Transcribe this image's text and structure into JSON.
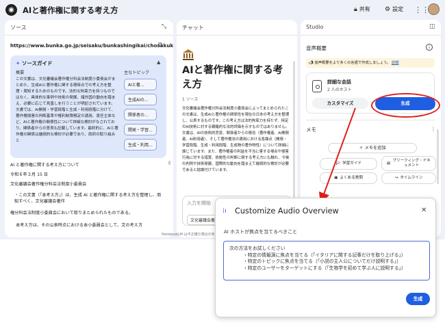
{
  "app": {
    "title": "AIと著作権に関する考え方",
    "share": "共有",
    "settings": "設定"
  },
  "source_panel": {
    "header": "ソース",
    "url": "https://www.bunka.go.jp/seisaku/bunkashingikai/chosakuken...",
    "guide": {
      "title": "ソースガイド",
      "summary_label": "概要",
      "topics_label": "主なトピック",
      "summary": "この文書は、文化審議会著作権分科会法制度小委員会がまとめた、生成AIと著作権に関する現時点での考え方を整理・周知するためのものです。法的な拘束力を持つものではなく、具体的な事例や技術の発展、諸外国の動向を踏まえ、必要に応じて見直しを行うことが明記されています。文書では、AI開発・学習段階と生成・利用段階に分けて、著作権侵害の判断基準や権利制限規定の適用、責任主体など、AIと著作権の関係性について詳細な検討がなされており、関係者からの意見も記載しています。最終的に、AIと著作権の関係は継続的な検討が必要であり、政府の取り組みと",
      "topics": [
        "AIと著...",
        "生成AIの...",
        "関係者の...",
        "開発・学習...",
        "生成・利用..."
      ]
    },
    "body": {
      "line1": "AI と著作権に関する考え方について",
      "line2": "令和６年３月 15 日",
      "line3": "文化審議会著作権分科会法制度小委員会",
      "bullet": "この文書（「本考え方」）は、生成 AI と著作権に関する考え方を整理し、周知すべく、文化審議会著作",
      "line4": "権分科会法制度小委員会において取りまとめられたものである。",
      "line5": "本考え方は、その公表時点における本小委員会として、文の考え方"
    },
    "footer": "NotebookLM は不正確な場合があります。"
  },
  "chat_panel": {
    "header": "チャット",
    "title": "AIと著作権に関する考え方",
    "count": "1 ソース",
    "body": "文化審議会著作権分科会法制度小委員会によってまとめられたこの文書は、生成AIと著作権の関係性を現在の日本の考え方を整理し、公表するものです。この考え方は法的拘束力を持たず、特定のAI技術に対する網羅的な法的評価を示すものではありません。文書は、AIの技術的背景、関係者からの懸念（著作権者、AI開発者、AI利用者）、そして著作権法の適用における各論点（開発・学習段階、生成・利用段階、生成物の著作物性）について詳細に論じています。また、著作権者の利益を不当に害する場合や侵害行為に対する措置、依拠性の判断に関する考え方にも触れ、今後の判例や技術発展、国際的な動向を踏まえて継続的な検討が必要であると結論付けています。",
    "input_placeholder": "入力を開始",
    "input_chip": "文化審議会著作権分..."
  },
  "studio_panel": {
    "header": "Studio",
    "audio_label": "音声概要",
    "banner_text": "音声概要をより多くの言語で作成しましょう。",
    "banner_link": "詳細",
    "card_title": "詳細な会話",
    "card_sub": "2 人のホスト",
    "customize": "カスタマイズ",
    "generate": "生成",
    "memo_label": "メモ",
    "add_note": "＋ メモを追加",
    "study_guide": "学習ガイド",
    "briefing": "ブリーフィング・ドキュメント",
    "faq": "よくある質問",
    "timeline": "タイムライン"
  },
  "modal": {
    "title": "Customize Audio Overview",
    "label": "AI ホストが焦点を当てるべきこと",
    "placeholder": "次の方法をお試しください",
    "items": [
      "・特定の情報源に焦点を当てる（「イタリアに関する記事だけを取り上げる」）",
      "・特定のトピックに焦点を当てる（「小説の主人公についてだけ説明する」）",
      "・特定のユーザーをターゲットにする（「生物学を初めて学ぶ人に説明する」）"
    ],
    "generate": "生成"
  },
  "colors": {
    "accent": "#1f5ee0",
    "annotation": "#e0201a",
    "guide_bg": "#dfe8fb"
  }
}
